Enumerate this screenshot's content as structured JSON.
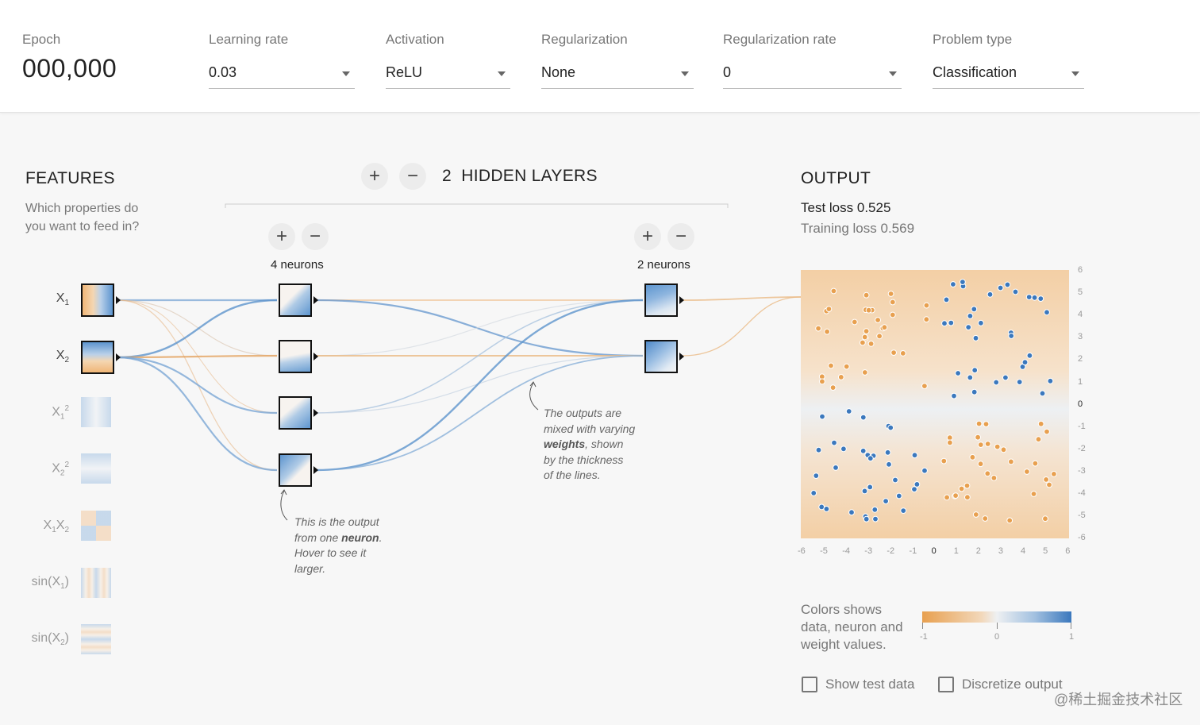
{
  "controls": {
    "epoch": {
      "label": "Epoch",
      "value": "000,000"
    },
    "learning_rate": {
      "label": "Learning rate",
      "value": "0.03"
    },
    "activation": {
      "label": "Activation",
      "value": "ReLU"
    },
    "regularization": {
      "label": "Regularization",
      "value": "None"
    },
    "regularization_rate": {
      "label": "Regularization rate",
      "value": "0"
    },
    "problem_type": {
      "label": "Problem type",
      "value": "Classification"
    }
  },
  "features": {
    "title": "FEATURES",
    "subtitle_line1": "Which properties do",
    "subtitle_line2": "you want to feed in?",
    "items": [
      {
        "name": "x1",
        "active": true
      },
      {
        "name": "x2",
        "active": true
      },
      {
        "name": "x1-squared",
        "active": false
      },
      {
        "name": "x2-squared",
        "active": false
      },
      {
        "name": "x1-times-x2",
        "active": false
      },
      {
        "name": "sin-x1",
        "active": false
      },
      {
        "name": "sin-x2",
        "active": false
      }
    ]
  },
  "hidden": {
    "count": "2",
    "title": "HIDDEN LAYERS",
    "add_icon": "plus-icon",
    "remove_icon": "minus-icon",
    "layers": [
      {
        "neurons_label": "4 neurons"
      },
      {
        "neurons_label": "2 neurons"
      }
    ]
  },
  "annotations": {
    "neuron": {
      "l1": "This is the output",
      "l2a": "from one ",
      "l2b": "neuron",
      "l2c": ".",
      "l3": "Hover to see it",
      "l4": "larger."
    },
    "weights": {
      "l1": "The outputs are",
      "l2": "mixed with varying",
      "l3a": "weights",
      "l3b": ", shown",
      "l4": "by the thickness",
      "l5": "of the lines."
    }
  },
  "output": {
    "title": "OUTPUT",
    "test_loss_label": "Test loss",
    "test_loss": "0.525",
    "training_loss_label": "Training loss",
    "training_loss": "0.569",
    "x_ticks": [
      "-6",
      "-5",
      "-4",
      "-3",
      "-2",
      "-1",
      "0",
      "1",
      "2",
      "3",
      "4",
      "5",
      "6"
    ],
    "y_ticks": [
      "6",
      "5",
      "4",
      "3",
      "2",
      "1",
      "0",
      "-1",
      "-2",
      "-3",
      "-4",
      "-5",
      "-6"
    ],
    "colors": {
      "orange": "#e8a04f",
      "blue": "#3b78bd"
    }
  },
  "legend": {
    "line1": "Colors shows",
    "line2": "data, neuron and",
    "line3": "weight values.",
    "min": "-1",
    "mid": "0",
    "max": "1"
  },
  "options": {
    "show_test_data": "Show test data",
    "discretize_output": "Discretize output"
  },
  "watermark": "@稀土掘金技术社区"
}
